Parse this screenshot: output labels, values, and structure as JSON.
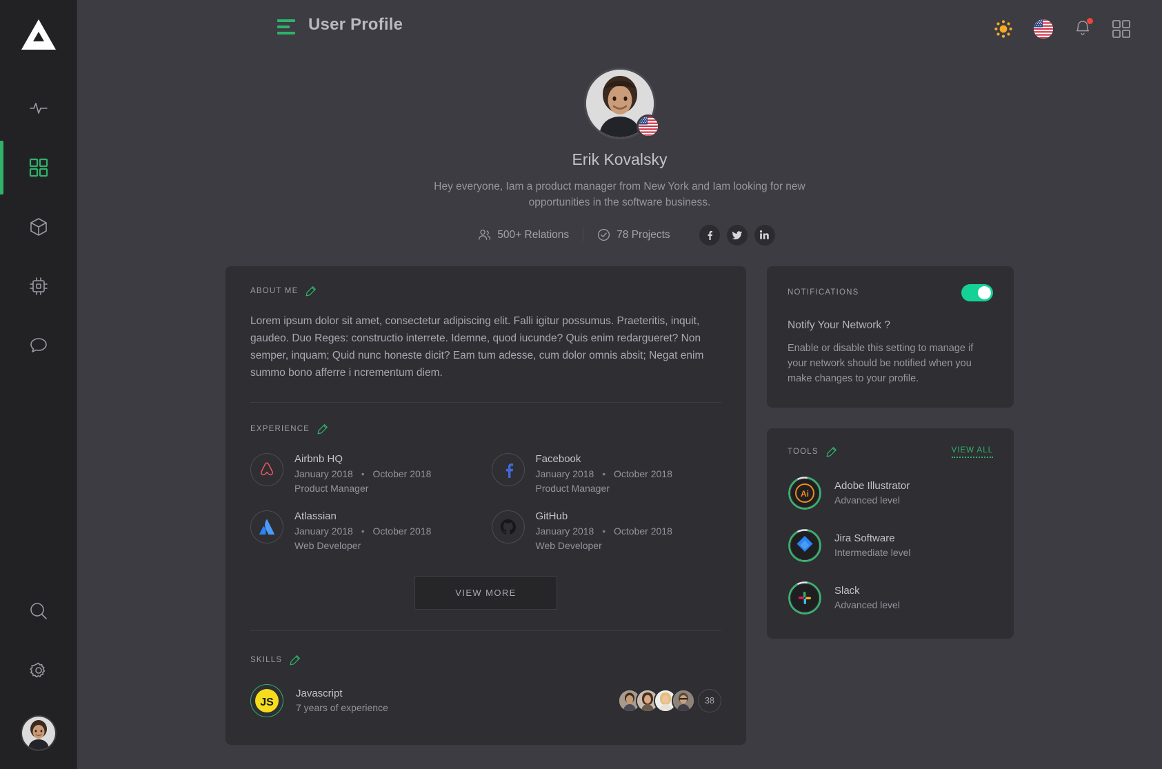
{
  "sidebar": {
    "logo_name": "triangle-logo",
    "items": [
      {
        "icon": "activity-pulse-icon",
        "active": false
      },
      {
        "icon": "grid-dashboard-icon",
        "active": true
      },
      {
        "icon": "cube-box-icon",
        "active": false
      },
      {
        "icon": "cpu-chip-icon",
        "active": false
      },
      {
        "icon": "chat-bubble-icon",
        "active": false
      }
    ],
    "bottom_items": [
      {
        "icon": "search-icon"
      },
      {
        "icon": "gear-settings-icon"
      }
    ],
    "avatar_name": "sidebar-user-avatar"
  },
  "topbar": {
    "menu_icon": "hamburger-menu-icon",
    "title": "User Profile",
    "actions": [
      {
        "icon": "sun-brightness-icon"
      },
      {
        "icon": "us-flag-icon"
      },
      {
        "icon": "bell-notification-icon",
        "has_badge": true
      },
      {
        "icon": "apps-grid-icon"
      }
    ]
  },
  "profile": {
    "name": "Erik Kovalsky",
    "bio": "Hey everyone,  Iam a product manager from New York and Iam looking for new opportunities in the software business.",
    "flag": "us-flag-icon",
    "stats": [
      {
        "icon": "users-icon",
        "label": "500+ Relations"
      },
      {
        "icon": "check-circle-icon",
        "label": "78 Projects"
      }
    ],
    "socials": [
      {
        "icon": "facebook-icon"
      },
      {
        "icon": "twitter-icon"
      },
      {
        "icon": "linkedin-icon"
      }
    ]
  },
  "about": {
    "title": "ABOUT ME",
    "edit_icon": "pencil-edit-icon",
    "text": "Lorem ipsum dolor sit amet, consectetur adipiscing elit. Falli igitur possumus. Praeteritis, inquit, gaudeo. Duo Reges: constructio interrete. Idemne, quod iucunde? Quis enim redargueret? Non semper, inquam; Quid nunc honeste dicit? Eam tum adesse, cum dolor omnis absit; Negat enim summo bono afferre i ncrementum diem."
  },
  "experience": {
    "title": "EXPERIENCE",
    "edit_icon": "pencil-edit-icon",
    "items": [
      {
        "company": "Airbnb HQ",
        "start": "January 2018",
        "end": "October 2018",
        "role": "Product Manager",
        "logo": "airbnb-logo-icon"
      },
      {
        "company": "Facebook",
        "start": "January 2018",
        "end": "October 2018",
        "role": "Product Manager",
        "logo": "facebook-logo-icon"
      },
      {
        "company": "Atlassian",
        "start": "January 2018",
        "end": "October 2018",
        "role": "Web Developer",
        "logo": "atlassian-logo-icon"
      },
      {
        "company": "GitHub",
        "start": "January 2018",
        "end": "October 2018",
        "role": "Web Developer",
        "logo": "github-logo-icon"
      }
    ],
    "view_more": "VIEW MORE"
  },
  "skills": {
    "title": "SKILLS",
    "edit_icon": "pencil-edit-icon",
    "items": [
      {
        "name": "Javascript",
        "experience": "7 years of experience",
        "logo": "javascript-logo-icon",
        "people_count": "38",
        "avatars": [
          "person-avatar-1",
          "person-avatar-2",
          "person-avatar-3",
          "person-avatar-4"
        ]
      }
    ]
  },
  "notifications": {
    "title": "NOTIFICATIONS",
    "enabled": true,
    "question": "Notify Your Network ?",
    "description": "Enable or disable this setting to manage if your network should be notified when you make changes to your profile."
  },
  "tools": {
    "title": "TOOLS",
    "edit_icon": "pencil-edit-icon",
    "view_all": "VIEW ALL",
    "items": [
      {
        "name": "Adobe Illustrator",
        "level": "Advanced level",
        "logo": "adobe-illustrator-icon",
        "progress": 88
      },
      {
        "name": "Jira Software",
        "level": "Intermediate level",
        "logo": "jira-software-icon",
        "progress": 88
      },
      {
        "name": "Slack",
        "level": "Advanced level",
        "logo": "slack-icon",
        "progress": 88
      }
    ]
  },
  "colors": {
    "accent_green": "#2fb36a",
    "toggle_green": "#14d295",
    "page_bg": "#3c3c42",
    "card_bg": "#2e2e33",
    "sidebar_bg": "#222225",
    "badge_red": "#f0443a"
  }
}
